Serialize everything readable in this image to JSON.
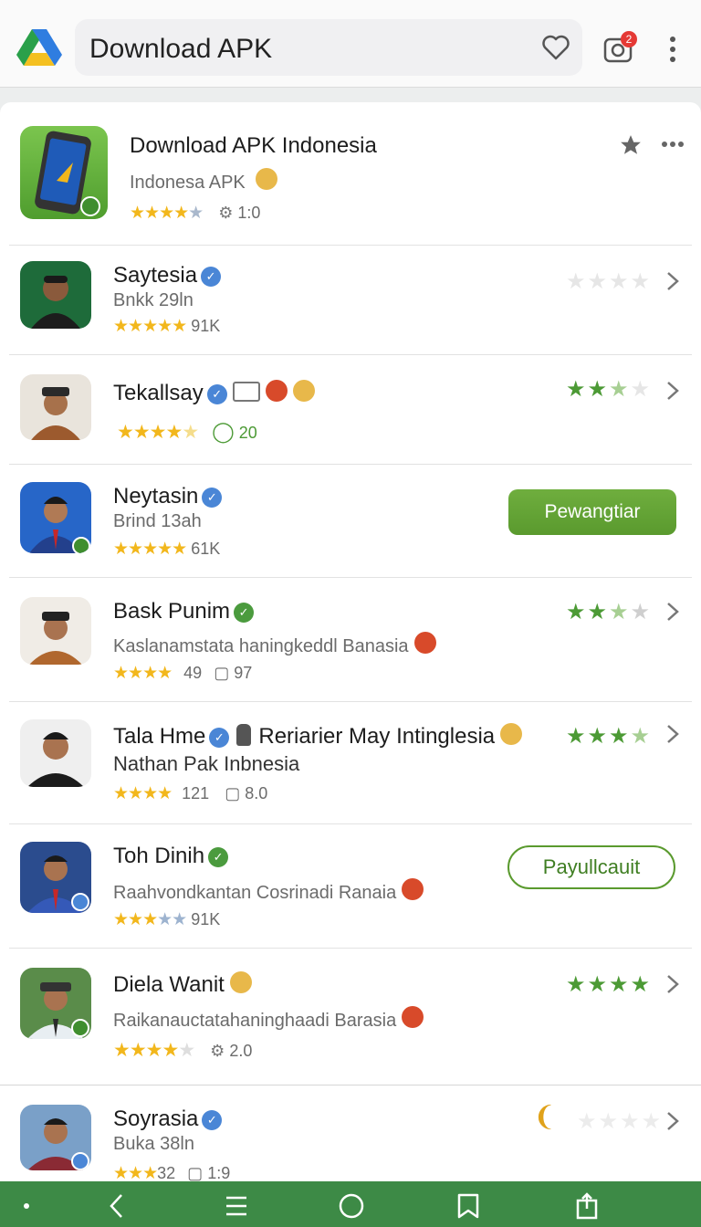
{
  "header": {
    "search_value": "Download APK",
    "notification_count": "2",
    "icons": [
      "app-logo-icon",
      "heart-icon",
      "camera-icon",
      "more-vert-icon"
    ]
  },
  "featured": {
    "title": "Download APK Indonesia",
    "subtitle": "Indonesa APK",
    "rating": 4,
    "count": "1:0",
    "icons": [
      "star-icon",
      "more-horiz-icon"
    ]
  },
  "apps": [
    {
      "title": "Saytesia",
      "subtitle": "Bnkk 29ln",
      "count": "91K",
      "right_rating": 0
    },
    {
      "title": "Tekallsay",
      "subtitle": "",
      "count": "20",
      "right_rating": 2.5
    },
    {
      "title": "Neytasin",
      "subtitle": "Brind 13ah",
      "count": "61K",
      "button": "Pewangtiar"
    },
    {
      "title": "Bask Punim",
      "subtitle": "Kaslanamstata haningkeddl Banasia",
      "score": "49",
      "count": "97",
      "right_rating": 2.5
    },
    {
      "title": "Tala Hme",
      "title_extra": "Reriarier May Intinglesia",
      "subtitle": "Nathan Pak Inbnesia",
      "score": "121",
      "count": "8.0",
      "right_rating": 3.5
    },
    {
      "title": "Toh Dinih",
      "subtitle": "Raahvondkantan Cosrinadi Ranaia",
      "count": "91K",
      "button": "Payullcauit"
    },
    {
      "title": "Diela Wanit",
      "subtitle": "Raikanauctatahaninghaadi Barasia",
      "count": "2.0",
      "right_rating": 4
    },
    {
      "title": "Soyrasia",
      "subtitle": "Buka 38ln",
      "score": "32",
      "count": "1:9",
      "right_rating": 0
    }
  ],
  "colors": {
    "accent_green": "#5a9a2e",
    "nav_green": "#3d8a46",
    "star_yellow": "#f2b71c",
    "verified_blue": "#4a86d6"
  },
  "navbar": {
    "icons": [
      "dot-icon",
      "back-icon",
      "recents-icon",
      "home-icon",
      "bookmark-icon",
      "share-icon"
    ]
  }
}
